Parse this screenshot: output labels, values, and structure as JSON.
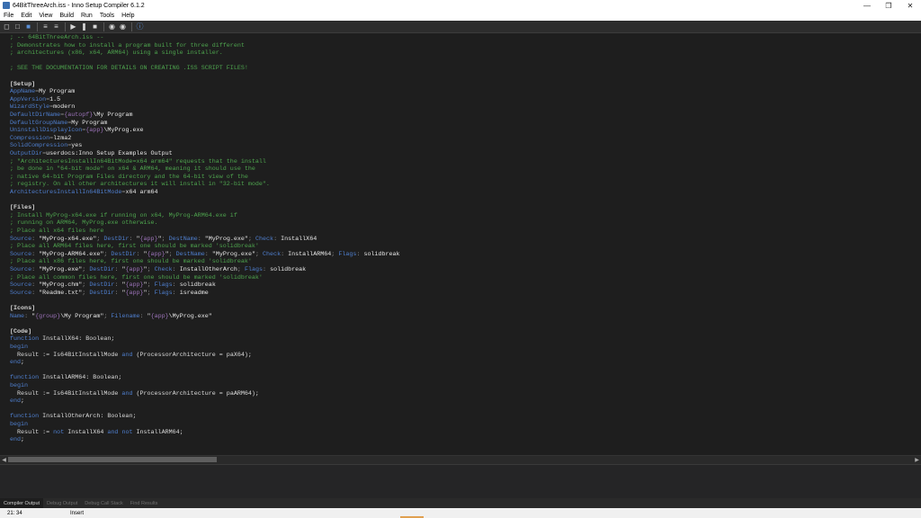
{
  "window": {
    "title": "64BitThreeArch.iss - Inno Setup Compiler 6.1.2"
  },
  "menu": [
    "File",
    "Edit",
    "View",
    "Build",
    "Run",
    "Tools",
    "Help"
  ],
  "colors": {
    "comment": "#4ea44e",
    "section": "#d4d4d4",
    "key": "#4f7fcf",
    "value": "#e8e8e8",
    "string": "#e8e8e8",
    "keyword": "#4f7fcf",
    "constant": "#9b72b8",
    "symbol": "#8a8a8a",
    "plain": "#dcdcdc"
  },
  "editor": {
    "lines": [
      [
        [
          "c",
          "; -- 64BitThreeArch.iss --"
        ]
      ],
      [
        [
          "c",
          "; Demonstrates how to install a program built for three different"
        ]
      ],
      [
        [
          "c",
          "; architectures (x86, x64, ARM64) using a single installer."
        ]
      ],
      [],
      [
        [
          "c",
          "; SEE THE DOCUMENTATION FOR DETAILS ON CREATING .ISS SCRIPT FILES!"
        ]
      ],
      [],
      [
        [
          "s",
          "[Setup]"
        ]
      ],
      [
        [
          "k",
          "AppName"
        ],
        [
          "y",
          "="
        ],
        [
          "v",
          "My Program"
        ]
      ],
      [
        [
          "k",
          "AppVersion"
        ],
        [
          "y",
          "="
        ],
        [
          "v",
          "1.5"
        ]
      ],
      [
        [
          "k",
          "WizardStyle"
        ],
        [
          "y",
          "="
        ],
        [
          "v",
          "modern"
        ]
      ],
      [
        [
          "k",
          "DefaultDirName"
        ],
        [
          "y",
          "="
        ],
        [
          "n",
          "{autopf}"
        ],
        [
          "v",
          "\\My Program"
        ]
      ],
      [
        [
          "k",
          "DefaultGroupName"
        ],
        [
          "y",
          "="
        ],
        [
          "v",
          "My Program"
        ]
      ],
      [
        [
          "k",
          "UninstallDisplayIcon"
        ],
        [
          "y",
          "="
        ],
        [
          "n",
          "{app}"
        ],
        [
          "v",
          "\\MyProg.exe"
        ]
      ],
      [
        [
          "k",
          "Compression"
        ],
        [
          "y",
          "="
        ],
        [
          "v",
          "lzma2"
        ]
      ],
      [
        [
          "k",
          "SolidCompression"
        ],
        [
          "y",
          "="
        ],
        [
          "v",
          "yes"
        ]
      ],
      [
        [
          "k",
          "OutputDir"
        ],
        [
          "y",
          "="
        ],
        [
          "v",
          "userdocs:Inno Setup Examples Output"
        ]
      ],
      [
        [
          "c",
          "; \"ArchitecturesInstallIn64BitMode=x64 arm64\" requests that the install"
        ]
      ],
      [
        [
          "c",
          "; be done in \"64-bit mode\" on x64 & ARM64, meaning it should use the"
        ]
      ],
      [
        [
          "c",
          "; native 64-bit Program Files directory and the 64-bit view of the"
        ]
      ],
      [
        [
          "c",
          "; registry. On all other architectures it will install in \"32-bit mode\"."
        ]
      ],
      [
        [
          "k",
          "ArchitecturesInstallIn64BitMode"
        ],
        [
          "y",
          "="
        ],
        [
          "v",
          "x64 arm64"
        ]
      ],
      [],
      [
        [
          "s",
          "[Files]"
        ]
      ],
      [
        [
          "c",
          "; Install MyProg-x64.exe if running on x64, MyProg-ARM64.exe if"
        ]
      ],
      [
        [
          "c",
          "; running on ARM64, MyProg.exe otherwise."
        ]
      ],
      [
        [
          "c",
          "; Place all x64 files here"
        ]
      ],
      [
        [
          "k",
          "Source"
        ],
        [
          "y",
          ": "
        ],
        [
          "v",
          "\"MyProg-x64.exe\""
        ],
        [
          "y",
          "; "
        ],
        [
          "k",
          "DestDir"
        ],
        [
          "y",
          ": "
        ],
        [
          "v",
          "\""
        ],
        [
          "n",
          "{app}"
        ],
        [
          "v",
          "\""
        ],
        [
          "y",
          "; "
        ],
        [
          "k",
          "DestName"
        ],
        [
          "y",
          ": "
        ],
        [
          "v",
          "\"MyProg.exe\""
        ],
        [
          "y",
          "; "
        ],
        [
          "k",
          "Check"
        ],
        [
          "y",
          ": "
        ],
        [
          "v",
          "InstallX64"
        ]
      ],
      [
        [
          "c",
          "; Place all ARM64 files here, first one should be marked 'solidbreak'"
        ]
      ],
      [
        [
          "k",
          "Source"
        ],
        [
          "y",
          ": "
        ],
        [
          "v",
          "\"MyProg-ARM64.exe\""
        ],
        [
          "y",
          "; "
        ],
        [
          "k",
          "DestDir"
        ],
        [
          "y",
          ": "
        ],
        [
          "v",
          "\""
        ],
        [
          "n",
          "{app}"
        ],
        [
          "v",
          "\""
        ],
        [
          "y",
          "; "
        ],
        [
          "k",
          "DestName"
        ],
        [
          "y",
          ": "
        ],
        [
          "v",
          "\"MyProg.exe\""
        ],
        [
          "y",
          "; "
        ],
        [
          "k",
          "Check"
        ],
        [
          "y",
          ": "
        ],
        [
          "v",
          "InstallARM64"
        ],
        [
          "y",
          "; "
        ],
        [
          "k",
          "Flags"
        ],
        [
          "y",
          ": "
        ],
        [
          "v",
          "solidbreak"
        ]
      ],
      [
        [
          "c",
          "; Place all x86 files here, first one should be marked 'solidbreak'"
        ]
      ],
      [
        [
          "k",
          "Source"
        ],
        [
          "y",
          ": "
        ],
        [
          "v",
          "\"MyProg.exe\""
        ],
        [
          "y",
          "; "
        ],
        [
          "k",
          "DestDir"
        ],
        [
          "y",
          ": "
        ],
        [
          "v",
          "\""
        ],
        [
          "n",
          "{app}"
        ],
        [
          "v",
          "\""
        ],
        [
          "y",
          "; "
        ],
        [
          "k",
          "Check"
        ],
        [
          "y",
          ": "
        ],
        [
          "v",
          "InstallOtherArch"
        ],
        [
          "y",
          "; "
        ],
        [
          "k",
          "Flags"
        ],
        [
          "y",
          ": "
        ],
        [
          "v",
          "solidbreak"
        ]
      ],
      [
        [
          "c",
          "; Place all common files here, first one should be marked 'solidbreak'"
        ]
      ],
      [
        [
          "k",
          "Source"
        ],
        [
          "y",
          ": "
        ],
        [
          "v",
          "\"MyProg.chm\""
        ],
        [
          "y",
          "; "
        ],
        [
          "k",
          "DestDir"
        ],
        [
          "y",
          ": "
        ],
        [
          "v",
          "\""
        ],
        [
          "n",
          "{app}"
        ],
        [
          "v",
          "\""
        ],
        [
          "y",
          "; "
        ],
        [
          "k",
          "Flags"
        ],
        [
          "y",
          ": "
        ],
        [
          "v",
          "solidbreak"
        ]
      ],
      [
        [
          "k",
          "Source"
        ],
        [
          "y",
          ": "
        ],
        [
          "v",
          "\"Readme.txt\""
        ],
        [
          "y",
          "; "
        ],
        [
          "k",
          "DestDir"
        ],
        [
          "y",
          ": "
        ],
        [
          "v",
          "\""
        ],
        [
          "n",
          "{app}"
        ],
        [
          "v",
          "\""
        ],
        [
          "y",
          "; "
        ],
        [
          "k",
          "Flags"
        ],
        [
          "y",
          ": "
        ],
        [
          "v",
          "isreadme"
        ]
      ],
      [],
      [
        [
          "s",
          "[Icons]"
        ]
      ],
      [
        [
          "k",
          "Name"
        ],
        [
          "y",
          ": "
        ],
        [
          "v",
          "\""
        ],
        [
          "n",
          "{group}"
        ],
        [
          "v",
          "\\My Program\""
        ],
        [
          "y",
          "; "
        ],
        [
          "k",
          "Filename"
        ],
        [
          "y",
          ": "
        ],
        [
          "v",
          "\""
        ],
        [
          "n",
          "{app}"
        ],
        [
          "v",
          "\\MyProg.exe\""
        ]
      ],
      [],
      [
        [
          "s",
          "[Code]"
        ]
      ],
      [
        [
          "w",
          "function"
        ],
        [
          "p",
          " InstallX64: Boolean;"
        ]
      ],
      [
        [
          "w",
          "begin"
        ]
      ],
      [
        [
          "p",
          "  Result := Is64BitInstallMode "
        ],
        [
          "w",
          "and"
        ],
        [
          "p",
          " (ProcessorArchitecture = paX64);"
        ]
      ],
      [
        [
          "w",
          "end"
        ],
        [
          "p",
          ";"
        ]
      ],
      [],
      [
        [
          "w",
          "function"
        ],
        [
          "p",
          " InstallARM64: Boolean;"
        ]
      ],
      [
        [
          "w",
          "begin"
        ]
      ],
      [
        [
          "p",
          "  Result := Is64BitInstallMode "
        ],
        [
          "w",
          "and"
        ],
        [
          "p",
          " (ProcessorArchitecture = paARM64);"
        ]
      ],
      [
        [
          "w",
          "end"
        ],
        [
          "p",
          ";"
        ]
      ],
      [],
      [
        [
          "w",
          "function"
        ],
        [
          "p",
          " InstallOtherArch: Boolean;"
        ]
      ],
      [
        [
          "w",
          "begin"
        ]
      ],
      [
        [
          "p",
          "  Result := "
        ],
        [
          "w",
          "not"
        ],
        [
          "p",
          " InstallX64 "
        ],
        [
          "w",
          "and not"
        ],
        [
          "p",
          " InstallARM64;"
        ]
      ],
      [
        [
          "w",
          "end"
        ],
        [
          "p",
          ";"
        ]
      ]
    ]
  },
  "output_tabs": [
    "Compiler Output",
    "Debug Output",
    "Debug Call Stack",
    "Find Results"
  ],
  "status": {
    "position": "21:  34",
    "mode": "Insert"
  }
}
